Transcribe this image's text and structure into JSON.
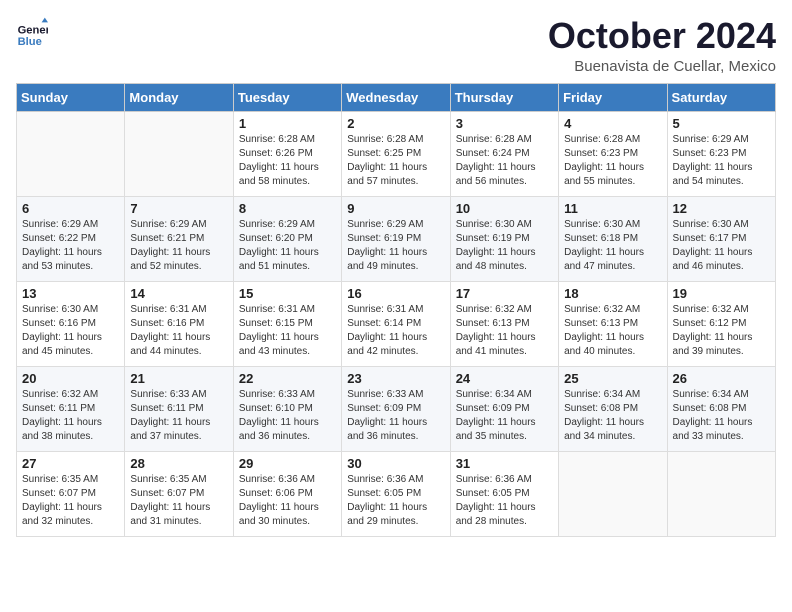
{
  "header": {
    "logo_line1": "General",
    "logo_line2": "Blue",
    "month_title": "October 2024",
    "location": "Buenavista de Cuellar, Mexico"
  },
  "weekdays": [
    "Sunday",
    "Monday",
    "Tuesday",
    "Wednesday",
    "Thursday",
    "Friday",
    "Saturday"
  ],
  "weeks": [
    [
      {
        "day": "",
        "sunrise": "",
        "sunset": "",
        "daylight": ""
      },
      {
        "day": "",
        "sunrise": "",
        "sunset": "",
        "daylight": ""
      },
      {
        "day": "1",
        "sunrise": "Sunrise: 6:28 AM",
        "sunset": "Sunset: 6:26 PM",
        "daylight": "Daylight: 11 hours and 58 minutes."
      },
      {
        "day": "2",
        "sunrise": "Sunrise: 6:28 AM",
        "sunset": "Sunset: 6:25 PM",
        "daylight": "Daylight: 11 hours and 57 minutes."
      },
      {
        "day": "3",
        "sunrise": "Sunrise: 6:28 AM",
        "sunset": "Sunset: 6:24 PM",
        "daylight": "Daylight: 11 hours and 56 minutes."
      },
      {
        "day": "4",
        "sunrise": "Sunrise: 6:28 AM",
        "sunset": "Sunset: 6:23 PM",
        "daylight": "Daylight: 11 hours and 55 minutes."
      },
      {
        "day": "5",
        "sunrise": "Sunrise: 6:29 AM",
        "sunset": "Sunset: 6:23 PM",
        "daylight": "Daylight: 11 hours and 54 minutes."
      }
    ],
    [
      {
        "day": "6",
        "sunrise": "Sunrise: 6:29 AM",
        "sunset": "Sunset: 6:22 PM",
        "daylight": "Daylight: 11 hours and 53 minutes."
      },
      {
        "day": "7",
        "sunrise": "Sunrise: 6:29 AM",
        "sunset": "Sunset: 6:21 PM",
        "daylight": "Daylight: 11 hours and 52 minutes."
      },
      {
        "day": "8",
        "sunrise": "Sunrise: 6:29 AM",
        "sunset": "Sunset: 6:20 PM",
        "daylight": "Daylight: 11 hours and 51 minutes."
      },
      {
        "day": "9",
        "sunrise": "Sunrise: 6:29 AM",
        "sunset": "Sunset: 6:19 PM",
        "daylight": "Daylight: 11 hours and 49 minutes."
      },
      {
        "day": "10",
        "sunrise": "Sunrise: 6:30 AM",
        "sunset": "Sunset: 6:19 PM",
        "daylight": "Daylight: 11 hours and 48 minutes."
      },
      {
        "day": "11",
        "sunrise": "Sunrise: 6:30 AM",
        "sunset": "Sunset: 6:18 PM",
        "daylight": "Daylight: 11 hours and 47 minutes."
      },
      {
        "day": "12",
        "sunrise": "Sunrise: 6:30 AM",
        "sunset": "Sunset: 6:17 PM",
        "daylight": "Daylight: 11 hours and 46 minutes."
      }
    ],
    [
      {
        "day": "13",
        "sunrise": "Sunrise: 6:30 AM",
        "sunset": "Sunset: 6:16 PM",
        "daylight": "Daylight: 11 hours and 45 minutes."
      },
      {
        "day": "14",
        "sunrise": "Sunrise: 6:31 AM",
        "sunset": "Sunset: 6:16 PM",
        "daylight": "Daylight: 11 hours and 44 minutes."
      },
      {
        "day": "15",
        "sunrise": "Sunrise: 6:31 AM",
        "sunset": "Sunset: 6:15 PM",
        "daylight": "Daylight: 11 hours and 43 minutes."
      },
      {
        "day": "16",
        "sunrise": "Sunrise: 6:31 AM",
        "sunset": "Sunset: 6:14 PM",
        "daylight": "Daylight: 11 hours and 42 minutes."
      },
      {
        "day": "17",
        "sunrise": "Sunrise: 6:32 AM",
        "sunset": "Sunset: 6:13 PM",
        "daylight": "Daylight: 11 hours and 41 minutes."
      },
      {
        "day": "18",
        "sunrise": "Sunrise: 6:32 AM",
        "sunset": "Sunset: 6:13 PM",
        "daylight": "Daylight: 11 hours and 40 minutes."
      },
      {
        "day": "19",
        "sunrise": "Sunrise: 6:32 AM",
        "sunset": "Sunset: 6:12 PM",
        "daylight": "Daylight: 11 hours and 39 minutes."
      }
    ],
    [
      {
        "day": "20",
        "sunrise": "Sunrise: 6:32 AM",
        "sunset": "Sunset: 6:11 PM",
        "daylight": "Daylight: 11 hours and 38 minutes."
      },
      {
        "day": "21",
        "sunrise": "Sunrise: 6:33 AM",
        "sunset": "Sunset: 6:11 PM",
        "daylight": "Daylight: 11 hours and 37 minutes."
      },
      {
        "day": "22",
        "sunrise": "Sunrise: 6:33 AM",
        "sunset": "Sunset: 6:10 PM",
        "daylight": "Daylight: 11 hours and 36 minutes."
      },
      {
        "day": "23",
        "sunrise": "Sunrise: 6:33 AM",
        "sunset": "Sunset: 6:09 PM",
        "daylight": "Daylight: 11 hours and 36 minutes."
      },
      {
        "day": "24",
        "sunrise": "Sunrise: 6:34 AM",
        "sunset": "Sunset: 6:09 PM",
        "daylight": "Daylight: 11 hours and 35 minutes."
      },
      {
        "day": "25",
        "sunrise": "Sunrise: 6:34 AM",
        "sunset": "Sunset: 6:08 PM",
        "daylight": "Daylight: 11 hours and 34 minutes."
      },
      {
        "day": "26",
        "sunrise": "Sunrise: 6:34 AM",
        "sunset": "Sunset: 6:08 PM",
        "daylight": "Daylight: 11 hours and 33 minutes."
      }
    ],
    [
      {
        "day": "27",
        "sunrise": "Sunrise: 6:35 AM",
        "sunset": "Sunset: 6:07 PM",
        "daylight": "Daylight: 11 hours and 32 minutes."
      },
      {
        "day": "28",
        "sunrise": "Sunrise: 6:35 AM",
        "sunset": "Sunset: 6:07 PM",
        "daylight": "Daylight: 11 hours and 31 minutes."
      },
      {
        "day": "29",
        "sunrise": "Sunrise: 6:36 AM",
        "sunset": "Sunset: 6:06 PM",
        "daylight": "Daylight: 11 hours and 30 minutes."
      },
      {
        "day": "30",
        "sunrise": "Sunrise: 6:36 AM",
        "sunset": "Sunset: 6:05 PM",
        "daylight": "Daylight: 11 hours and 29 minutes."
      },
      {
        "day": "31",
        "sunrise": "Sunrise: 6:36 AM",
        "sunset": "Sunset: 6:05 PM",
        "daylight": "Daylight: 11 hours and 28 minutes."
      },
      {
        "day": "",
        "sunrise": "",
        "sunset": "",
        "daylight": ""
      },
      {
        "day": "",
        "sunrise": "",
        "sunset": "",
        "daylight": ""
      }
    ]
  ]
}
